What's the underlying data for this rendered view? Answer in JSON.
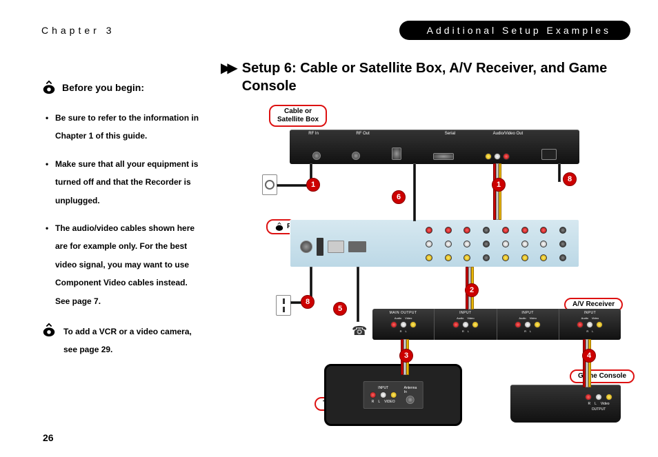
{
  "header": {
    "chapter_label": "Chapter 3",
    "section_title": "Additional Setup Examples"
  },
  "sidebar": {
    "before_title": "Before you begin:",
    "bullets": [
      "Be sure to refer to the information in Chapter 1 of this guide.",
      "Make sure that all your equipment is turned off and that the Recorder is unplugged.",
      "The audio/video cables shown here are for example only. For the best video signal, you may want to use Component Video cables instead. See page 7."
    ],
    "vcr_note": "To add a VCR or a video camera, see page 29."
  },
  "main": {
    "title": "Setup 6: Cable or Satellite Box, A/V Receiver, and Game Console",
    "device_labels": {
      "satbox": "Cable or\nSatellite Box",
      "recorder": "Recorder",
      "av_receiver": "A/V Receiver",
      "television": "Television",
      "game_console": "Game Console"
    },
    "sat_port_labels": [
      "RF In",
      "RF Out",
      "",
      "Serial",
      "Audio/Video Out",
      ""
    ],
    "av_sections": [
      {
        "title": "MAIN OUTPUT",
        "sub": [
          "Audio",
          "",
          "Video"
        ],
        "tiny": [
          "R",
          "L",
          ""
        ]
      },
      {
        "title": "INPUT",
        "sub": [
          "Audio",
          "",
          "Video"
        ],
        "tiny": [
          "R",
          "L",
          ""
        ]
      },
      {
        "title": "INPUT",
        "sub": [
          "Audio",
          "",
          "Video"
        ],
        "tiny": [
          "R",
          "L",
          ""
        ]
      },
      {
        "title": "INPUT",
        "sub": [
          "Audio",
          "",
          "Video"
        ],
        "tiny": [
          "R",
          "L",
          ""
        ]
      }
    ],
    "tv_labels": {
      "input": "INPUT",
      "antenna": "Antenna\nIn",
      "rlv": [
        "R",
        "L",
        "VIDEO"
      ]
    },
    "console_labels": {
      "rlv": [
        "R",
        "L",
        "Video"
      ],
      "out": "OUTPUT"
    },
    "steps": [
      "1",
      "2",
      "3",
      "4",
      "5",
      "6",
      "8"
    ]
  },
  "page_number": "26"
}
